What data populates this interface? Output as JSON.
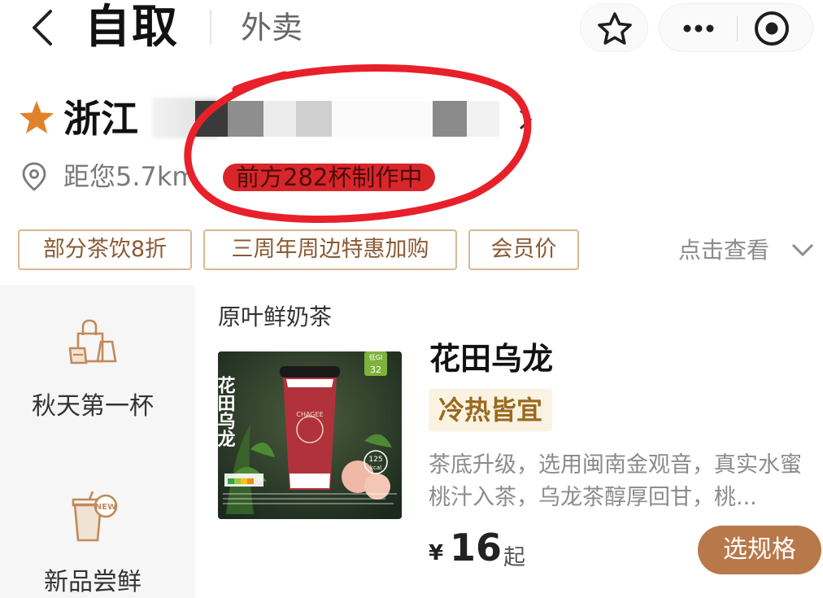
{
  "topbar": {
    "tab_pickup": "自取",
    "tab_delivery": "外卖",
    "icons": [
      "back-arrow-icon",
      "star-outline-icon",
      "more-dots-icon",
      "target-circle-icon"
    ]
  },
  "store": {
    "name": "浙江",
    "distance": "距您5.7km",
    "queue_status": "前方282杯制作中",
    "icons": [
      "star-icon",
      "location-pin-icon",
      "chevron-right-icon"
    ]
  },
  "promo_tags": [
    "部分茶饮8折",
    "三周年周边特惠加购",
    "会员价"
  ],
  "view_more": "点击查看",
  "sidebar": {
    "items": [
      {
        "label": "秋天第一杯",
        "icon": "shopping-bags-icon"
      },
      {
        "label": "新品尝鲜",
        "icon": "new-cup-icon"
      }
    ]
  },
  "section": {
    "title": "原叶鲜奶茶"
  },
  "product": {
    "name": "花田乌龙",
    "image_text": "花田乌龙",
    "cup_brand": "CHAGEE",
    "image_badge_top": "低GI",
    "image_badge_value": "32",
    "image_kcal": "125",
    "image_kcal_unit": "kcal",
    "temp_badge": "冷热皆宜",
    "description": "茶底升级，选用闽南金观音，真实水蜜桃汁入茶，乌龙茶醇厚回甘，桃...",
    "currency": "¥",
    "price": "16",
    "price_suffix": "起",
    "select_button": "选规格"
  },
  "colors": {
    "accent_brown": "#b8784a",
    "tag_border": "#d9b892",
    "star_orange": "#e0822c",
    "queue_red": "#d8262a",
    "circle_red": "#e8202a"
  }
}
